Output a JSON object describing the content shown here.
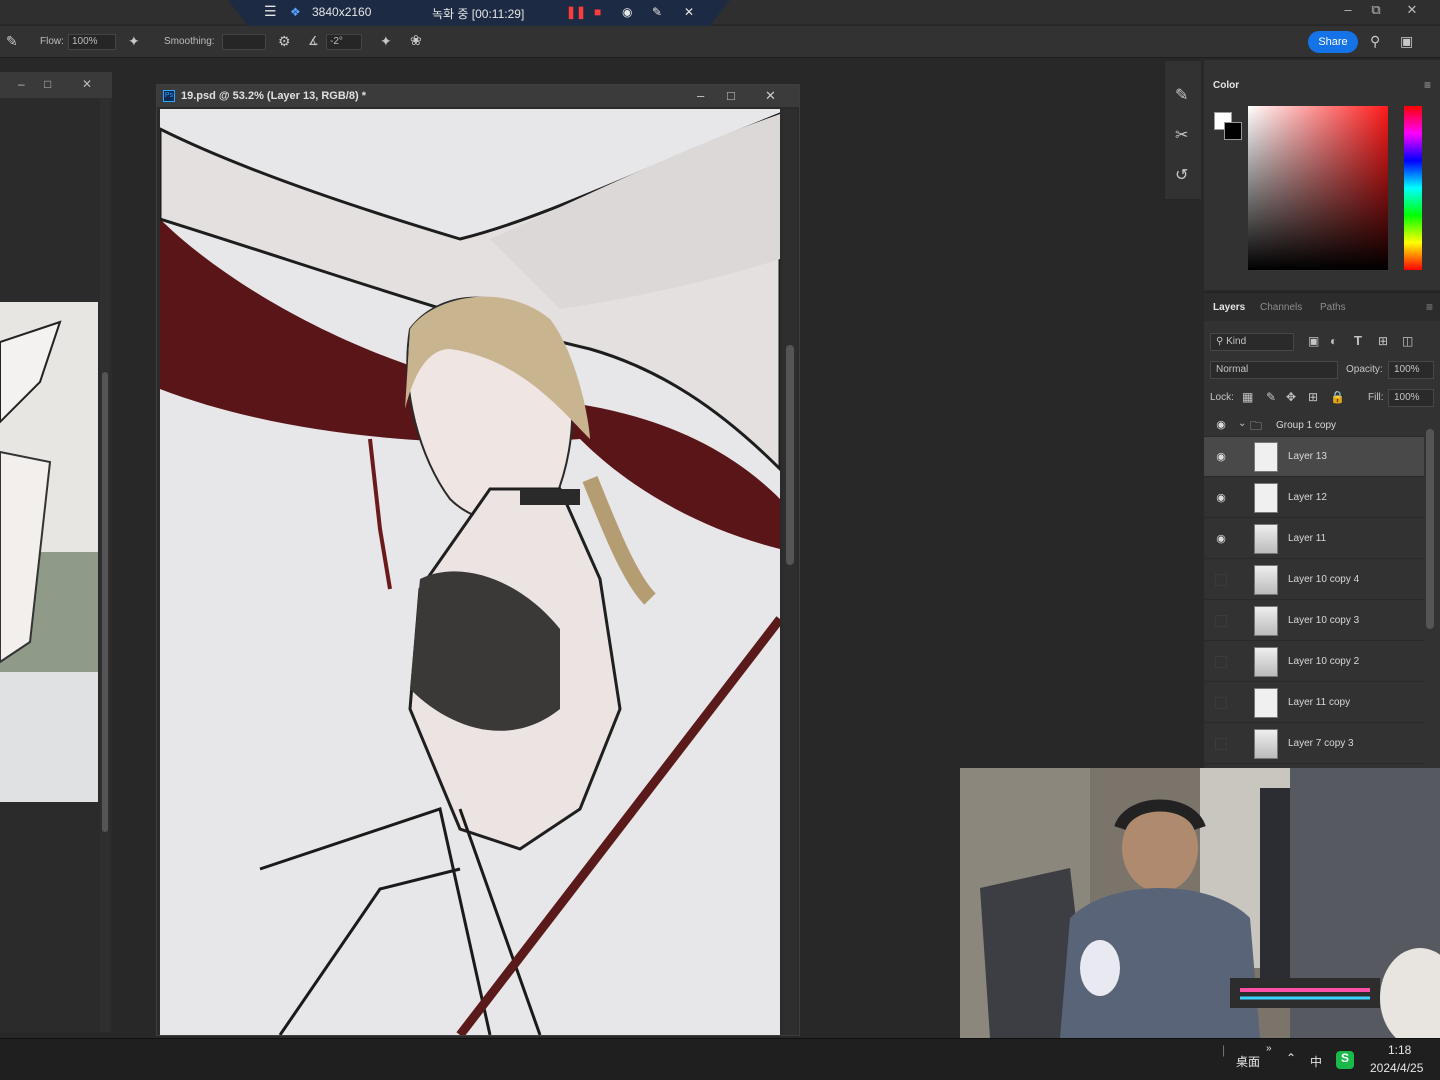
{
  "recorder": {
    "resolution": "3840x2160",
    "status": "녹화 중 [00:11:29]"
  },
  "options": {
    "flow_label": "Flow:",
    "flow_value": "100%",
    "smoothing_label": "Smoothing:",
    "smoothing_value": "",
    "angle_value": "-2°",
    "share_label": "Share"
  },
  "document": {
    "title": "19.psd @ 53.2% (Layer 13, RGB/8) *",
    "app_badge": "Ps"
  },
  "color_panel": {
    "tab": "Color",
    "foreground": "#ffffff",
    "background": "#000000"
  },
  "layers_panel": {
    "tabs": [
      "Layers",
      "Channels",
      "Paths"
    ],
    "filter_kind": "Kind",
    "blend_mode": "Normal",
    "opacity_label": "Opacity:",
    "opacity_value": "100%",
    "lock_label": "Lock:",
    "fill_label": "Fill:",
    "fill_value": "100%",
    "group_name": "Group 1 copy",
    "layers": [
      {
        "name": "Layer 13",
        "visible": true,
        "active": true
      },
      {
        "name": "Layer 12",
        "visible": true,
        "active": false
      },
      {
        "name": "Layer 11",
        "visible": true,
        "active": false
      },
      {
        "name": "Layer 10 copy 4",
        "visible": false,
        "active": false
      },
      {
        "name": "Layer 10 copy 3",
        "visible": false,
        "active": false
      },
      {
        "name": "Layer 10 copy 2",
        "visible": false,
        "active": false
      },
      {
        "name": "Layer 11 copy",
        "visible": false,
        "active": false
      },
      {
        "name": "Layer 7 copy 3",
        "visible": false,
        "active": false
      }
    ]
  },
  "taskbar": {
    "desktop_label": "桌面",
    "ime": "中",
    "time": "1:18",
    "date": "2024/4/25"
  }
}
